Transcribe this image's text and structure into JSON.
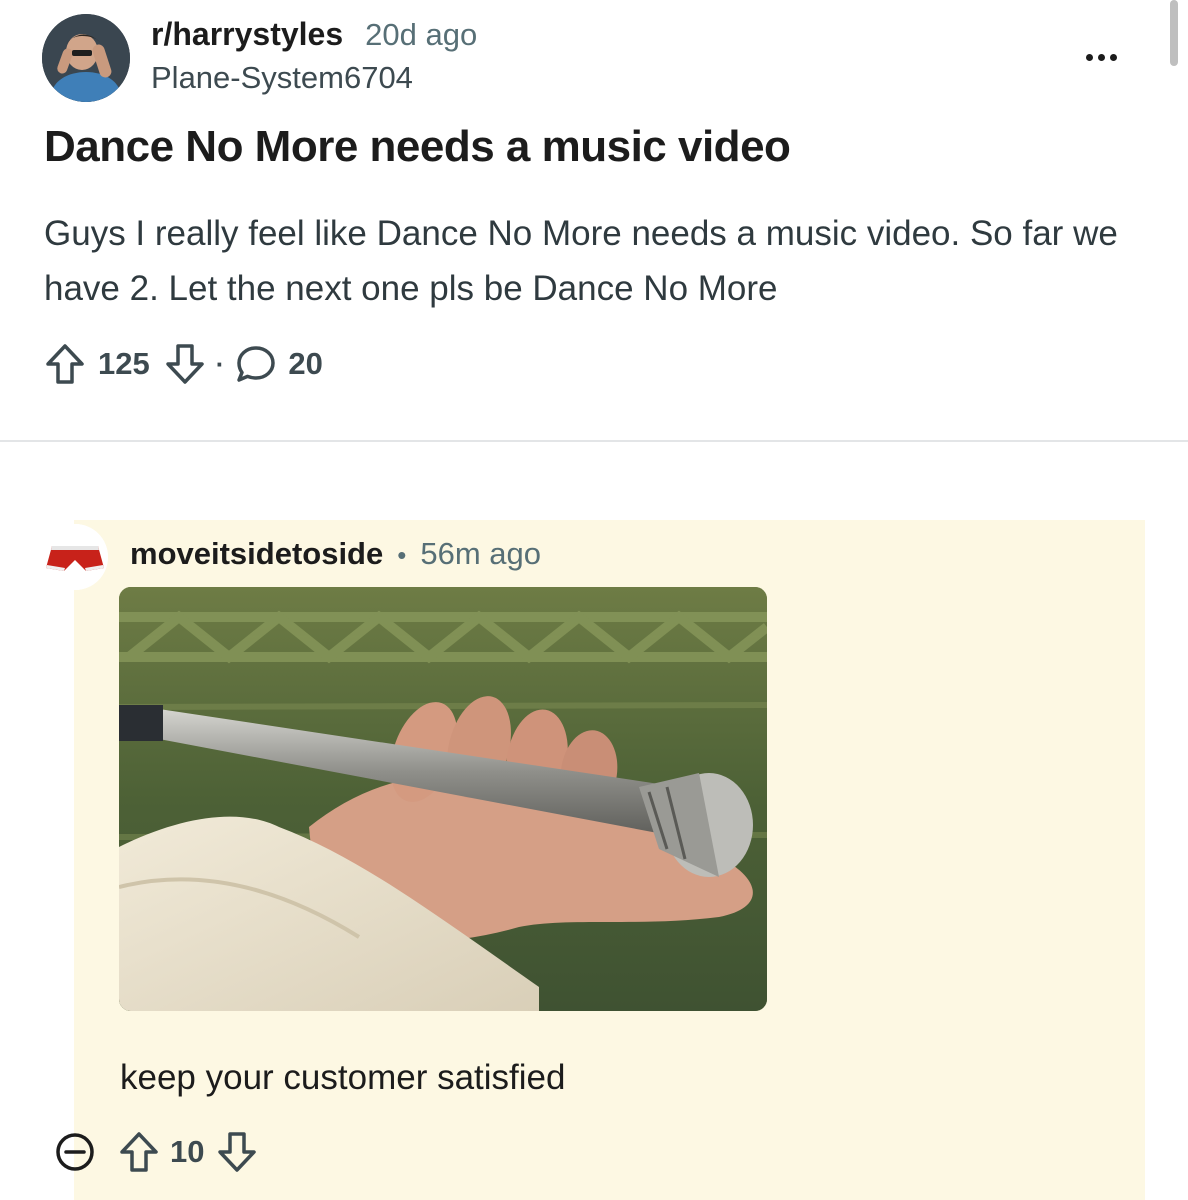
{
  "post": {
    "subreddit": "r/harrystyles",
    "time": "20d ago",
    "author": "Plane-System6704",
    "title": "Dance No More needs a music video",
    "body": "Guys I really feel like Dance No More needs a music video. So far we have 2. Let the next one pls be Dance No More",
    "upvotes": "125",
    "comments": "20",
    "separator": "·"
  },
  "comment": {
    "author": "moveitsidetoside",
    "separator": "•",
    "time": "56m ago",
    "text": "keep your customer satisfied",
    "upvotes": "10"
  },
  "icons": {
    "more": "more-horizontal-icon",
    "upvote": "arrow-up-outline-icon",
    "downvote": "arrow-down-outline-icon",
    "comments": "speech-bubble-icon",
    "collapse": "minus-circle-icon"
  },
  "colors": {
    "comment_highlight": "#fdf8e3",
    "meta_text": "#576f76",
    "divider": "#e3e5e7"
  }
}
